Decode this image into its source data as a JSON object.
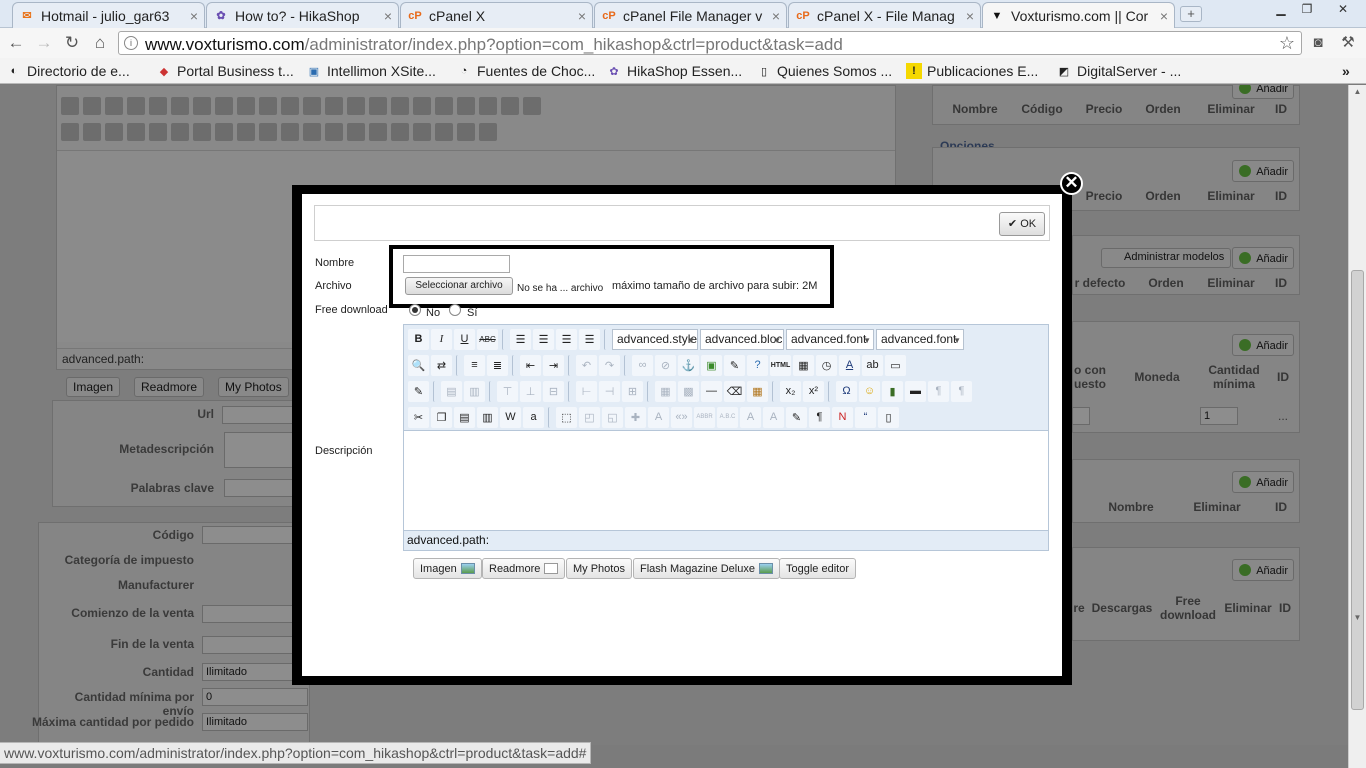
{
  "browser": {
    "tabs": [
      {
        "title": "Hotmail - julio_gar63",
        "icon": "mail-icon",
        "color": "#e8731a",
        "active": false
      },
      {
        "title": "How to? - HikaShop",
        "icon": "hikashop-icon",
        "color": "#6a4fb2",
        "active": false
      },
      {
        "title": "cPanel X",
        "icon": "cpanel-icon",
        "color": "#e86a1a",
        "active": false
      },
      {
        "title": "cPanel File Manager v",
        "icon": "cpanel-icon",
        "color": "#e86a1a",
        "active": false
      },
      {
        "title": "cPanel X - File Manag",
        "icon": "cpanel-icon",
        "color": "#e86a1a",
        "active": false
      },
      {
        "title": "Voxturismo.com || Cor",
        "icon": "voxturismo-icon",
        "color": "#111111",
        "active": true
      }
    ],
    "url_host": "www.voxturismo.com",
    "url_path": "/administrator/index.php?option=com_hikashop&ctrl=product&task=add",
    "bookmarks": [
      {
        "label": "Directorio de e...",
        "icon": "bookmark-icon"
      },
      {
        "label": "Portal Business t...",
        "icon": "bookmark-icon"
      },
      {
        "label": "Intellimon XSite...",
        "icon": "bookmark-icon"
      },
      {
        "label": "Fuentes de Choc...",
        "icon": "bookmark-icon"
      },
      {
        "label": "HikaShop Essen...",
        "icon": "bookmark-icon"
      },
      {
        "label": "Quienes Somos ...",
        "icon": "bookmark-icon"
      },
      {
        "label": "Publicaciones E...",
        "icon": "bookmark-icon"
      },
      {
        "label": "DigitalServer - ...",
        "icon": "bookmark-icon"
      }
    ],
    "status_url": "www.voxturismo.com/administrator/index.php?option=com_hikashop&ctrl=product&task=add#"
  },
  "background": {
    "editor_path": "advanced.path:",
    "buttons": [
      "Imagen",
      "Readmore",
      "My Photos"
    ],
    "left_labels": {
      "url": "Url",
      "meta": "Metadescripción",
      "keywords": "Palabras clave",
      "code": "Código",
      "tax": "Categoría de impuesto",
      "manufacturer": "Manufacturer",
      "sale_start": "Comienzo de la venta",
      "sale_end": "Fin de la venta",
      "quantity": "Cantidad",
      "min_qty": "Cantidad mínima por envío",
      "max_qty": "Máxima cantidad por pedido"
    },
    "left_values": {
      "quantity": "Ilimitado",
      "min_qty": "0",
      "max_qty": "Ilimitado"
    },
    "right": {
      "add_label": "Añadir",
      "table1_headers": [
        "Nombre",
        "Código",
        "Precio",
        "Orden",
        "Eliminar",
        "ID"
      ],
      "options_title": "Opciones",
      "table2_headers": [
        "Precio",
        "Orden",
        "Eliminar",
        "ID"
      ],
      "manage_models": "Administrar modelos",
      "table3_headers": [
        "r defecto",
        "Orden",
        "Eliminar",
        "ID"
      ],
      "table4_headers": [
        "o con",
        "uesto",
        "Moneda",
        "Cantidad",
        "mínima",
        "ID"
      ],
      "table4_qty": "1",
      "table4_dash": "...",
      "table5_headers": [
        "Nombre",
        "Eliminar",
        "ID"
      ],
      "table6_headers": [
        "re",
        "Descargas",
        "Free",
        "download",
        "Eliminar",
        "ID"
      ]
    }
  },
  "modal": {
    "ok_label": "OK",
    "name_label": "Nombre",
    "file_label": "Archivo",
    "file_button": "Seleccionar archivo",
    "file_none": "No se ha ... archivo",
    "file_max": "máximo tamaño de archivo para subir: 2M",
    "free_download_label": "Free download",
    "radio_no": "No",
    "radio_si": "Sí",
    "free_download_value": "No",
    "description_label": "Descripción",
    "dropdowns": [
      "advanced.style",
      "advanced.bloc",
      "advanced.font",
      "advanced.font"
    ],
    "editor_path": "advanced.path:",
    "editor_buttons": [
      "Imagen",
      "Readmore",
      "My Photos",
      "Flash Magazine Deluxe",
      "Toggle editor"
    ]
  }
}
